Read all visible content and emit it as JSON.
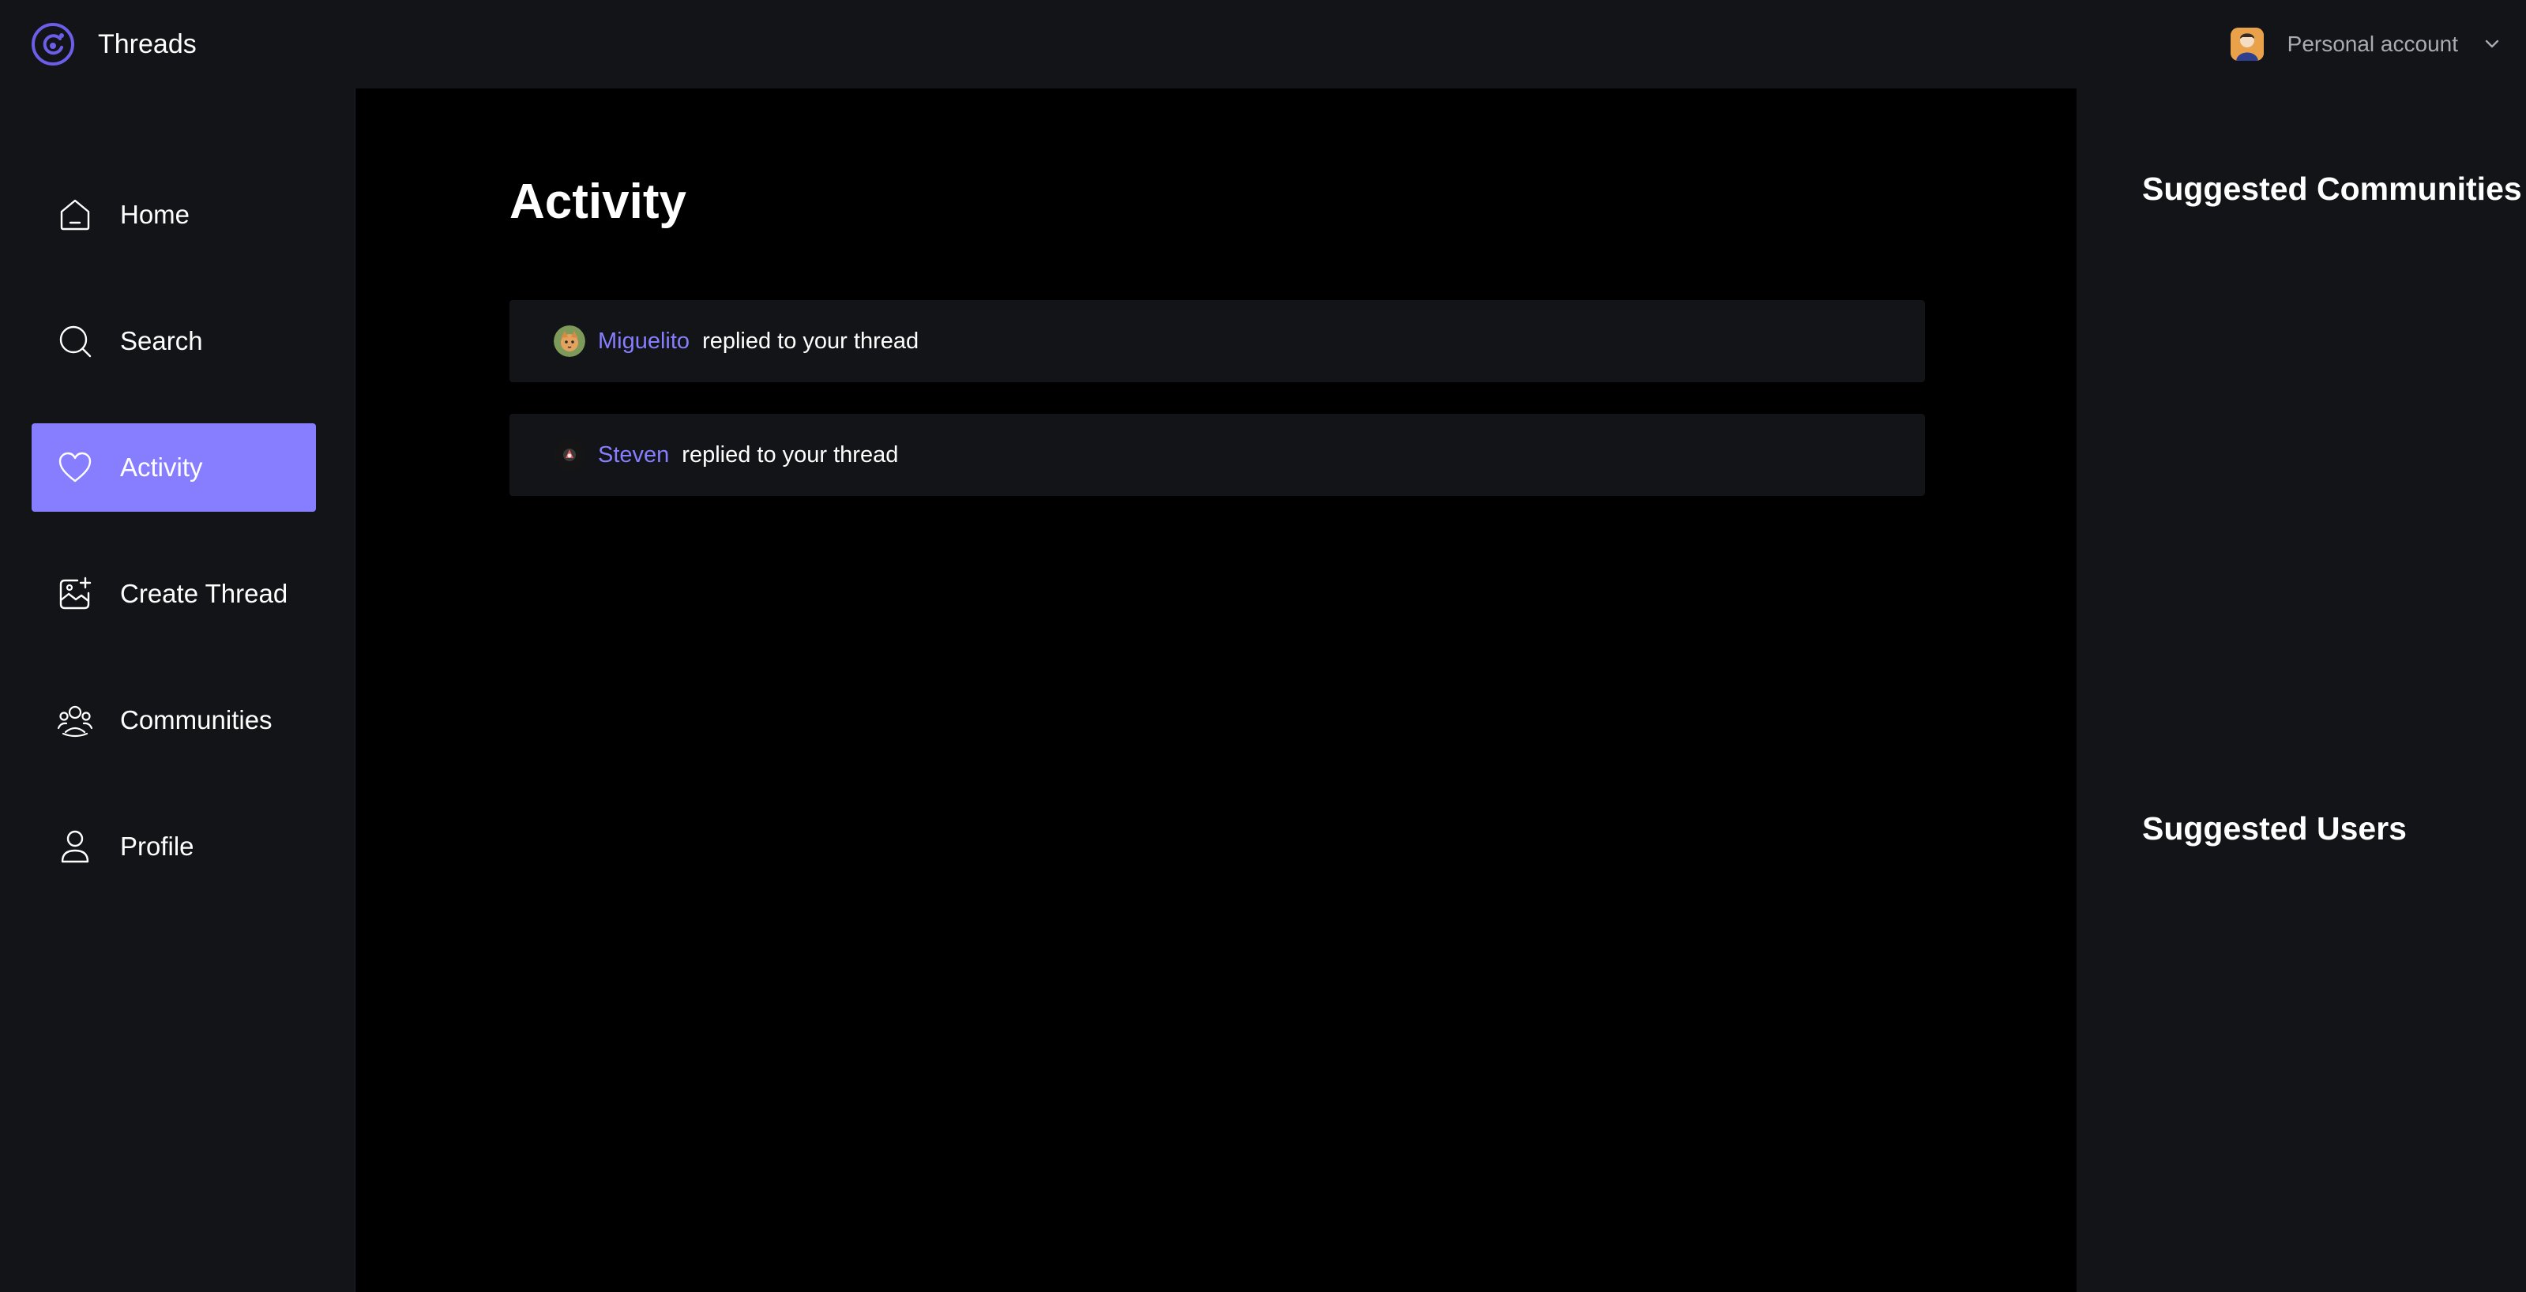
{
  "app": {
    "name": "Threads",
    "account_label": "Personal account"
  },
  "sidebar": {
    "items": [
      {
        "label": "Home",
        "icon": "home-icon",
        "active": false
      },
      {
        "label": "Search",
        "icon": "search-icon",
        "active": false
      },
      {
        "label": "Activity",
        "icon": "heart-icon",
        "active": true
      },
      {
        "label": "Create Thread",
        "icon": "create-thread-icon",
        "active": false
      },
      {
        "label": "Communities",
        "icon": "communities-icon",
        "active": false
      },
      {
        "label": "Profile",
        "icon": "user-icon",
        "active": false
      }
    ]
  },
  "main": {
    "title": "Activity",
    "activities": [
      {
        "user": "Miguelito",
        "text": "replied to your thread"
      },
      {
        "user": "Steven",
        "text": "replied to your thread"
      }
    ]
  },
  "rightbar": {
    "communities_heading": "Suggested Communities",
    "users_heading": "Suggested Users"
  },
  "colors": {
    "accent": "#877eff",
    "panel": "#121417",
    "background": "#000000"
  }
}
